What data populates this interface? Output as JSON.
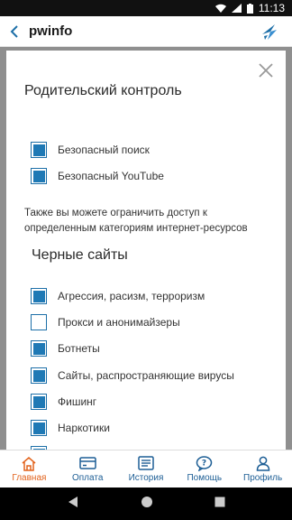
{
  "status_bar": {
    "time": "11:13"
  },
  "app_bar": {
    "title": "pwinfo"
  },
  "dialog": {
    "title": "Родительский контроль",
    "options": [
      {
        "label": "Безопасный поиск",
        "checked": true
      },
      {
        "label": "Безопасный YouTube",
        "checked": true
      }
    ],
    "info": "Также вы можете ограничить доступ к определенным категориям интернет-ресурсов",
    "blacklist_title": "Черные сайты",
    "categories": [
      {
        "label": "Агрессия, расизм, терроризм",
        "checked": true
      },
      {
        "label": "Прокси и анонимайзеры",
        "checked": false
      },
      {
        "label": "Ботнеты",
        "checked": true
      },
      {
        "label": "Сайты, распространяющие вирусы",
        "checked": true
      },
      {
        "label": "Фишинг",
        "checked": true
      },
      {
        "label": "Наркотики",
        "checked": true
      }
    ]
  },
  "bottom_nav": {
    "items": [
      {
        "label": "Главная",
        "icon": "home-icon",
        "active": true
      },
      {
        "label": "Оплата",
        "icon": "card-icon",
        "active": false
      },
      {
        "label": "История",
        "icon": "history-icon",
        "active": false
      },
      {
        "label": "Помощь",
        "icon": "help-chat-icon",
        "active": false
      },
      {
        "label": "Профиль",
        "icon": "profile-icon",
        "active": false
      }
    ]
  },
  "colors": {
    "accent": "#1f79b5",
    "active_nav": "#e2621b",
    "nav": "#1d5e95"
  }
}
